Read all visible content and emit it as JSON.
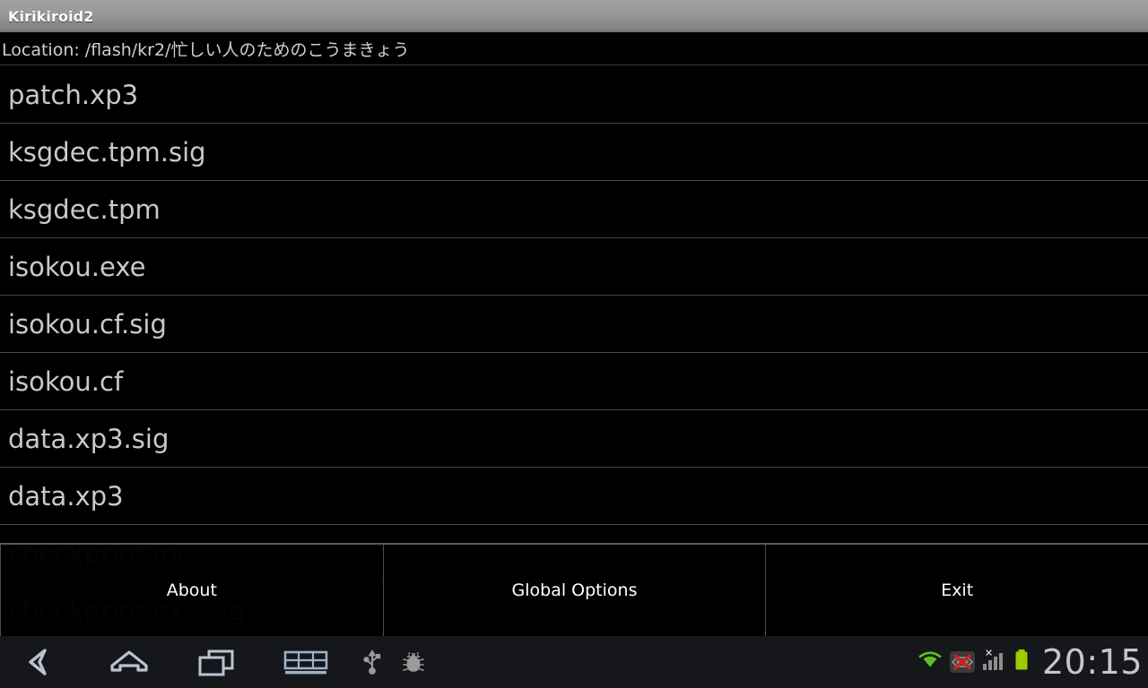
{
  "window": {
    "title": "Kirikiroid2"
  },
  "location": {
    "label": "Location: /flash/kr2/忙しい人のためのこうまきょう"
  },
  "file_list": {
    "items": [
      {
        "name": "patch.xp3",
        "dim": false
      },
      {
        "name": "ksgdec.tpm.sig",
        "dim": false
      },
      {
        "name": "ksgdec.tpm",
        "dim": false
      },
      {
        "name": "isokou.exe",
        "dim": false
      },
      {
        "name": "isokou.cf.sig",
        "dim": false
      },
      {
        "name": "isokou.cf",
        "dim": false
      },
      {
        "name": "data.xp3.sig",
        "dim": false
      },
      {
        "name": "data.xp3",
        "dim": false
      },
      {
        "name": "checkprint.ini",
        "dim": true
      },
      {
        "name": "checkprint.exe.sig",
        "dim": true
      }
    ]
  },
  "button_panel": {
    "buttons": [
      {
        "label": "About"
      },
      {
        "label": "Global Options"
      },
      {
        "label": "Exit"
      }
    ]
  },
  "nav_bar": {
    "icons": [
      {
        "name": "back-icon"
      },
      {
        "name": "home-icon"
      },
      {
        "name": "recents-icon"
      },
      {
        "name": "keyboard-icon"
      },
      {
        "name": "usb-icon"
      },
      {
        "name": "debug-bug-icon"
      }
    ],
    "status": {
      "wifi": "wifi-icon",
      "ethernet": "ethernet-disconnected-icon",
      "signal": "signal-bars-no-service-icon",
      "battery": "battery-full-icon",
      "clock": "20:15"
    }
  },
  "colors": {
    "title_bar_top": "#a0a0a0",
    "title_bar_bottom": "#6d6d6d",
    "list_text": "#c9c9c9",
    "dim_text": "#1b1b1b",
    "separator": "#4a4a4a",
    "nav_bar_bg": "#15171a",
    "nav_icon": "#aab4c4",
    "battery_green": "#9ccb00",
    "wifi_green": "#5fbf1f",
    "error_red": "#d32020",
    "clock_text": "#c6c6c6"
  }
}
